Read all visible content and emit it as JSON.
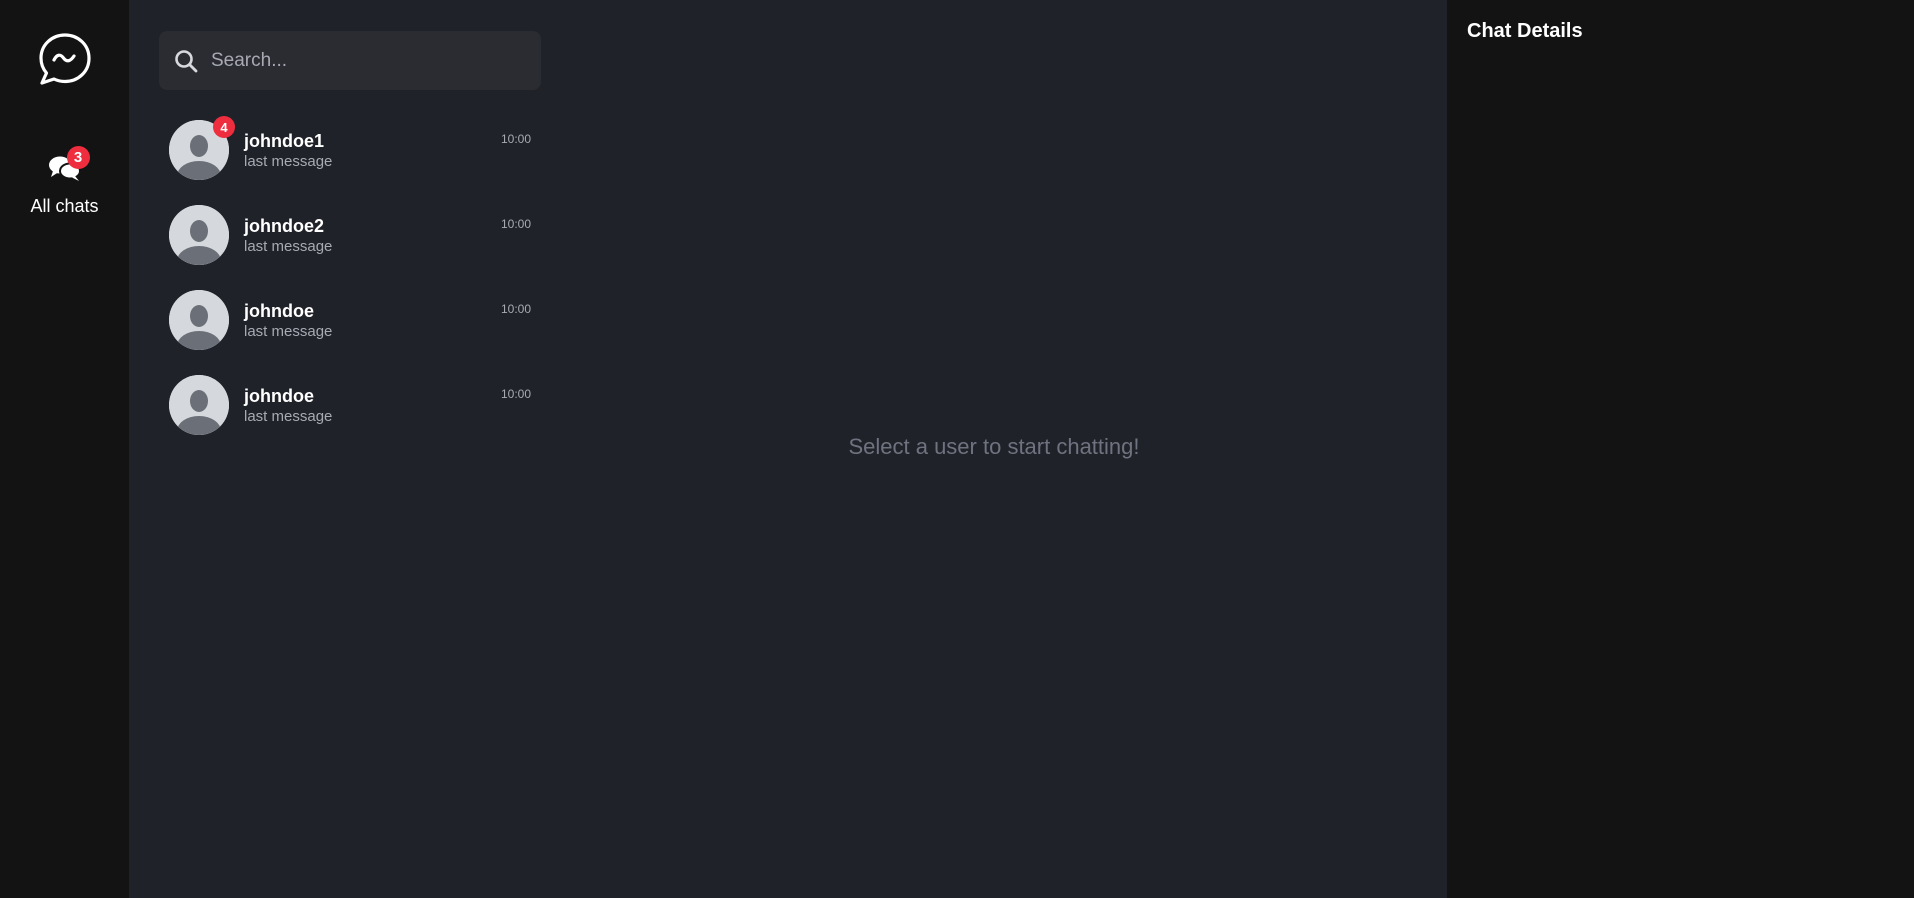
{
  "nav": {
    "logo_icon": "chat-bubble-wave-icon",
    "items": [
      {
        "label": "All chats",
        "icon": "chat-bubbles-icon",
        "badge": "3"
      }
    ]
  },
  "search": {
    "placeholder": "Search...",
    "value": ""
  },
  "chats": [
    {
      "name": "johndoe1",
      "last_message": "last message",
      "time": "10:00",
      "unread": "4"
    },
    {
      "name": "johndoe2",
      "last_message": "last message",
      "time": "10:00",
      "unread": null
    },
    {
      "name": "johndoe",
      "last_message": "last message",
      "time": "10:00",
      "unread": null
    },
    {
      "name": "johndoe",
      "last_message": "last message",
      "time": "10:00",
      "unread": null
    }
  ],
  "main": {
    "empty_text": "Select a user to start chatting!"
  },
  "details": {
    "title": "Chat Details"
  },
  "colors": {
    "badge": "#ee2e3e",
    "rail_bg": "#131313",
    "panel_bg": "#202229"
  }
}
